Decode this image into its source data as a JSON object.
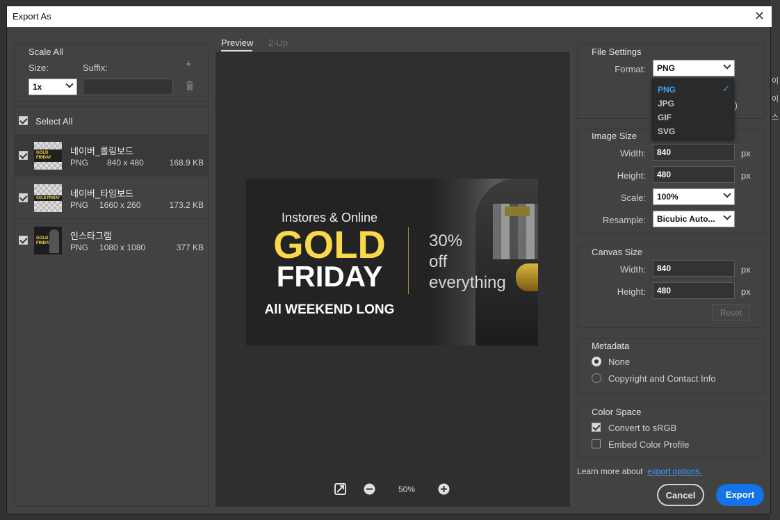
{
  "dialog": {
    "title": "Export As"
  },
  "background_app": {
    "strip_text": [
      "이",
      "이",
      "스"
    ]
  },
  "scale_all": {
    "title": "Scale All",
    "size_label": "Size:",
    "suffix_label": "Suffix:",
    "size_value": "1x",
    "suffix_value": ""
  },
  "select_all": {
    "label": "Select All",
    "checked": true
  },
  "assets": [
    {
      "name": "네이버_롤링보드",
      "format": "PNG",
      "dimensions": "840 x 480",
      "size": "168.9 KB",
      "checked": true,
      "selected": true,
      "thumb_text": "GOLD FRIDAY"
    },
    {
      "name": "네이버_타임보드",
      "format": "PNG",
      "dimensions": "1660 x 260",
      "size": "173.2 KB",
      "checked": true,
      "selected": false,
      "thumb_text": "GOLD FRIDAY"
    },
    {
      "name": "인스타그램",
      "format": "PNG",
      "dimensions": "1080 x 1080",
      "size": "377 KB",
      "checked": true,
      "selected": false,
      "thumb_text": "GOLD FRIDAY"
    }
  ],
  "preview": {
    "tabs": [
      {
        "label": "Preview",
        "active": true
      },
      {
        "label": "2-Up",
        "active": false
      }
    ],
    "zoom": "50%",
    "banner": {
      "line1": "Instores & Online",
      "gold": "GOLD",
      "friday": "FRIDAY",
      "weekend": "All WEEKEND LONG",
      "offer_l1": "30%",
      "offer_l2": "off",
      "offer_l3": "everything"
    }
  },
  "file_settings": {
    "title": "File Settings",
    "format_label": "Format:",
    "format_value": "PNG",
    "format_options": [
      "PNG",
      "JPG",
      "GIF",
      "SVG"
    ],
    "hidden_text_fragment": "t)"
  },
  "image_size": {
    "title": "Image Size",
    "width_label": "Width:",
    "width_value": "840",
    "width_unit": "px",
    "height_label": "Height:",
    "height_value": "480",
    "height_unit": "px",
    "scale_label": "Scale:",
    "scale_value": "100%",
    "resample_label": "Resample:",
    "resample_value": "Bicubic Auto..."
  },
  "canvas_size": {
    "title": "Canvas Size",
    "width_label": "Width:",
    "width_value": "840",
    "width_unit": "px",
    "height_label": "Height:",
    "height_value": "480",
    "height_unit": "px",
    "reset_label": "Reset"
  },
  "metadata": {
    "title": "Metadata",
    "options": [
      {
        "label": "None",
        "selected": true
      },
      {
        "label": "Copyright and Contact Info",
        "selected": false
      }
    ]
  },
  "color_space": {
    "title": "Color Space",
    "options": [
      {
        "label": "Convert to sRGB",
        "checked": true
      },
      {
        "label": "Embed Color Profile",
        "checked": false
      }
    ]
  },
  "footer": {
    "learn_text": "Learn more about",
    "learn_link": "export options.",
    "cancel_label": "Cancel",
    "export_label": "Export"
  },
  "colors": {
    "accent": "#1473e6",
    "gold": "#f9d84a",
    "link": "#3d9ef5"
  }
}
